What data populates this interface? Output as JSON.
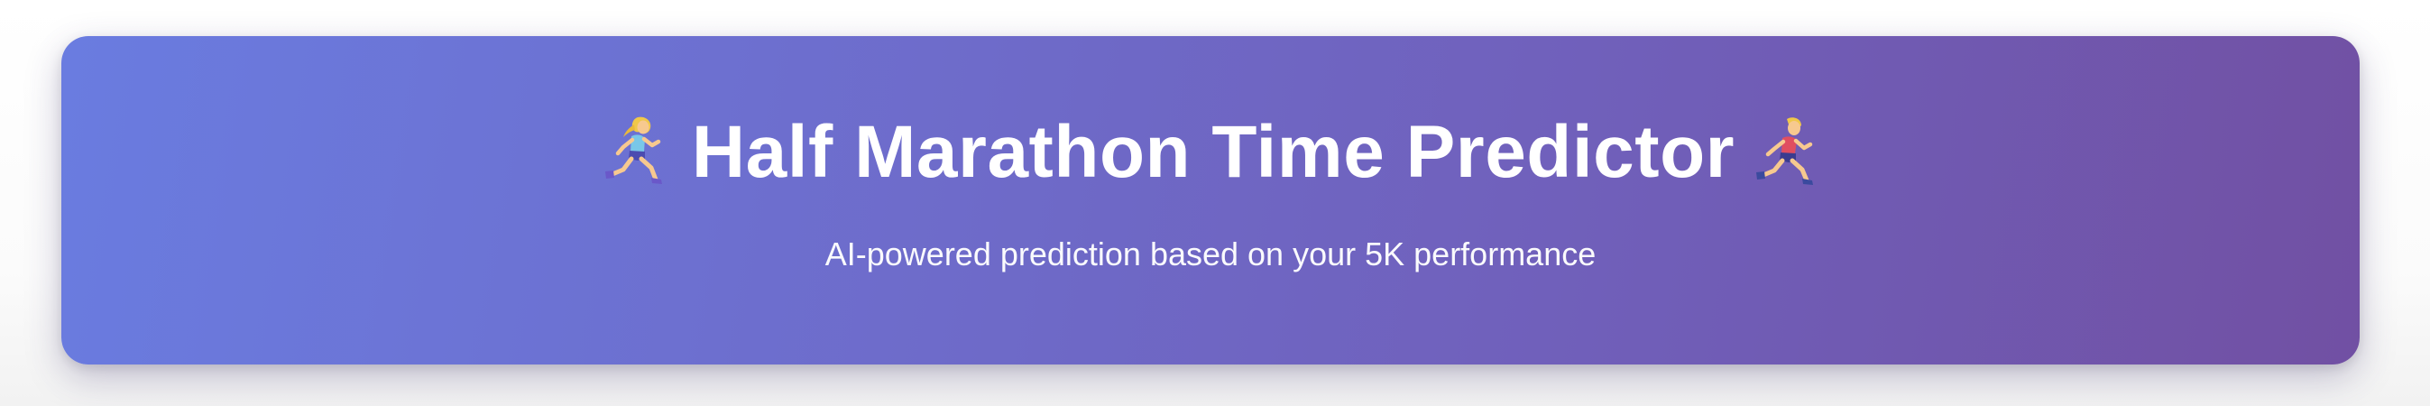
{
  "header": {
    "title": "Half Marathon Time Predictor",
    "subtitle": "AI-powered prediction based on your 5K performance",
    "left_icon": "woman-running-icon",
    "right_icon": "man-running-icon"
  },
  "colors": {
    "gradient_start": "#6a7ce0",
    "gradient_end": "#7150a3",
    "text": "#ffffff"
  }
}
